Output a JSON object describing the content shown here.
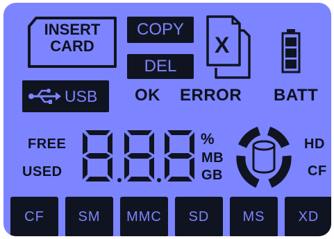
{
  "insert_card": {
    "line1": "INSERT",
    "line2": "CARD"
  },
  "copy_label": "COPY",
  "del_label": "DEL",
  "usb_label": "USB",
  "status": {
    "ok": "OK",
    "error": "ERROR",
    "batt": "BATT"
  },
  "capacity": {
    "free": "FREE",
    "used": "USED",
    "percent": "%",
    "mb": "MB",
    "gb": "GB"
  },
  "disk": {
    "hd": "HD",
    "cf": "CF"
  },
  "display_digits": "888",
  "card_slots": [
    "CF",
    "SM",
    "MMC",
    "SD",
    "MS",
    "XD"
  ],
  "colors": {
    "lcd_background": "#7c84ff",
    "segment_dark": "#101420"
  }
}
